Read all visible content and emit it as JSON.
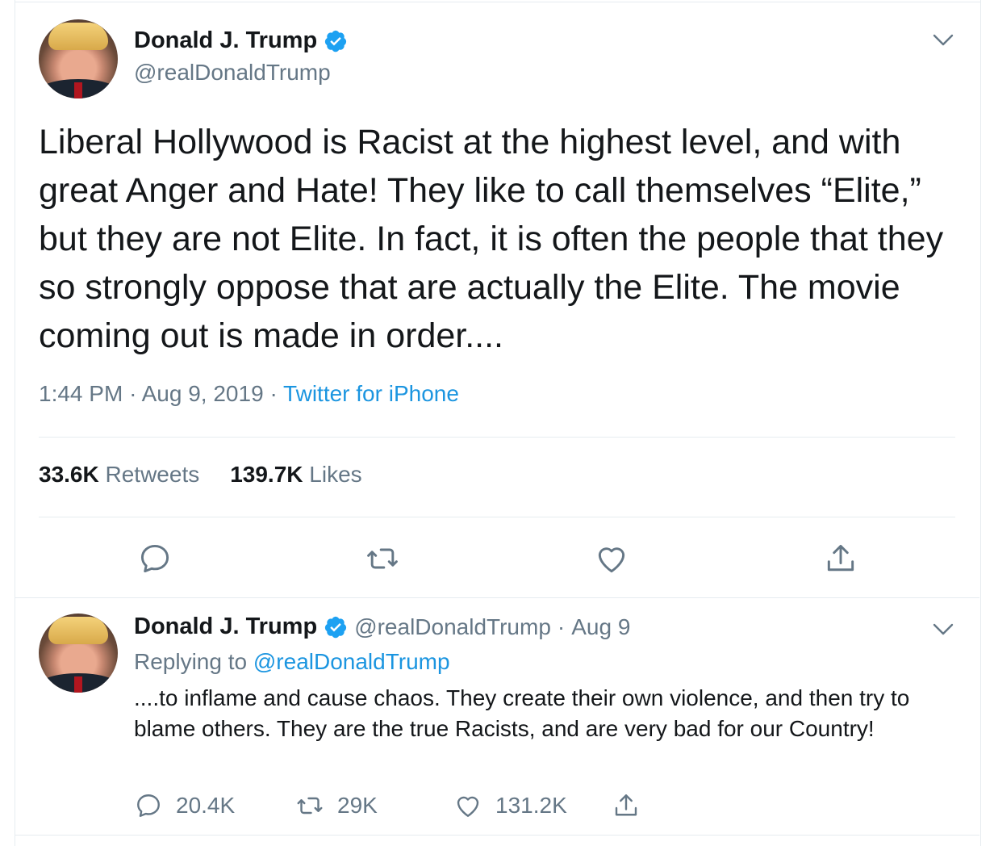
{
  "main_tweet": {
    "author_name": "Donald J. Trump",
    "handle": "@realDonaldTrump",
    "text": "Liberal Hollywood is Racist at the highest level, and with great Anger and Hate! They like to call themselves “Elite,” but they are not Elite. In fact, it is often the people that they so strongly oppose that are actually the Elite. The movie coming out is made in order....",
    "time": "1:44 PM",
    "date": "Aug 9, 2019",
    "source": "Twitter for iPhone",
    "retweets_count": "33.6K",
    "retweets_label": "Retweets",
    "likes_count": "139.7K",
    "likes_label": "Likes"
  },
  "reply_tweet": {
    "author_name": "Donald J. Trump",
    "handle": "@realDonaldTrump",
    "date": "Aug 9",
    "replying_prefix": "Replying to",
    "replying_to": "@realDonaldTrump",
    "text": "....to inflame and cause chaos. They create their own violence, and then try to blame others. They are the true Racists, and are very bad for our Country!",
    "reply_count": "20.4K",
    "retweet_count": "29K",
    "like_count": "131.2K"
  },
  "separator": "·",
  "colors": {
    "text": "#14171a",
    "secondary": "#657786",
    "link": "#1b95e0",
    "verified": "#1da1f2",
    "border": "#e6ecf0"
  },
  "icons": [
    "verified-badge-icon",
    "chevron-down-icon",
    "reply-icon",
    "retweet-icon",
    "like-icon",
    "share-icon"
  ]
}
